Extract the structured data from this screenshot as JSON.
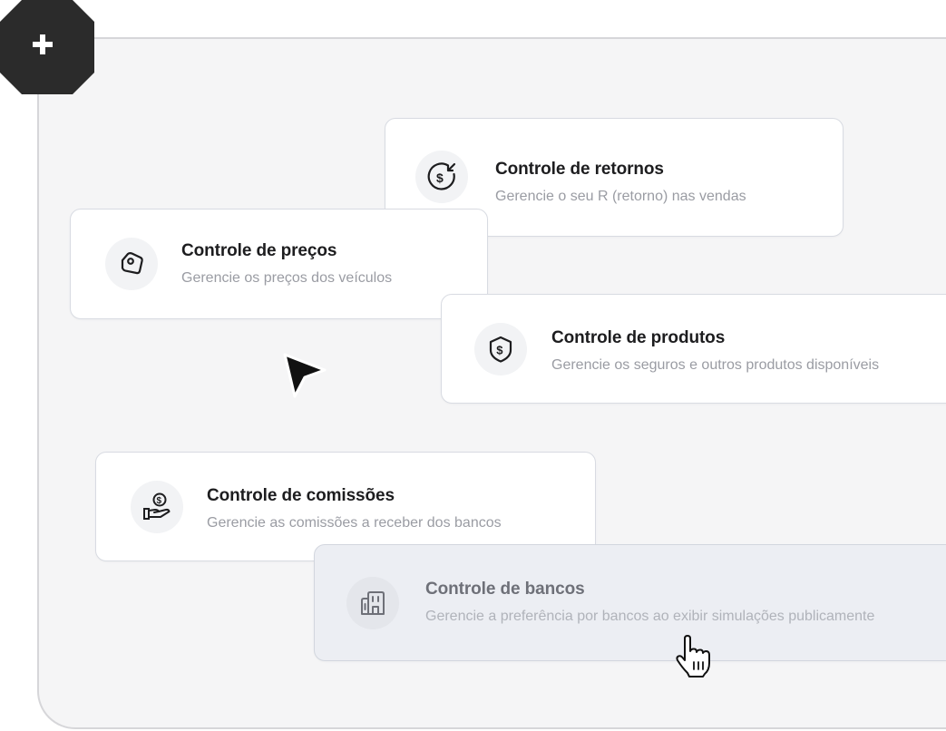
{
  "badge": {
    "icon": "plus-icon"
  },
  "cards": {
    "retornos": {
      "icon": "dollar-return-icon",
      "title": "Controle de retornos",
      "description": "Gerencie o seu R (retorno) nas vendas"
    },
    "precos": {
      "icon": "price-tag-icon",
      "title": "Controle de preços",
      "description": "Gerencie os preços dos veículos"
    },
    "produtos": {
      "icon": "dollar-shield-icon",
      "title": "Controle de produtos",
      "description": "Gerencie os seguros e outros produtos disponíveis"
    },
    "comissoes": {
      "icon": "hand-coin-icon",
      "title": "Controle de comissões",
      "description": "Gerencie as comissões a receber dos bancos"
    },
    "bancos": {
      "icon": "bank-building-icon",
      "title": "Controle de bancos",
      "description": "Gerencie a preferência por bancos ao exibir simulações publicamente"
    }
  },
  "cursors": {
    "arrow": "arrow-cursor-icon",
    "hand": "hand-pointer-cursor-icon"
  },
  "colors": {
    "panel_background": "#f5f5f6",
    "panel_border": "#d6d6d9",
    "card_background": "#ffffff",
    "card_hover_background": "#eceef3",
    "title_text": "#1d1d1f",
    "description_text": "#9a9ca3",
    "badge_background": "#2b2b2b"
  }
}
